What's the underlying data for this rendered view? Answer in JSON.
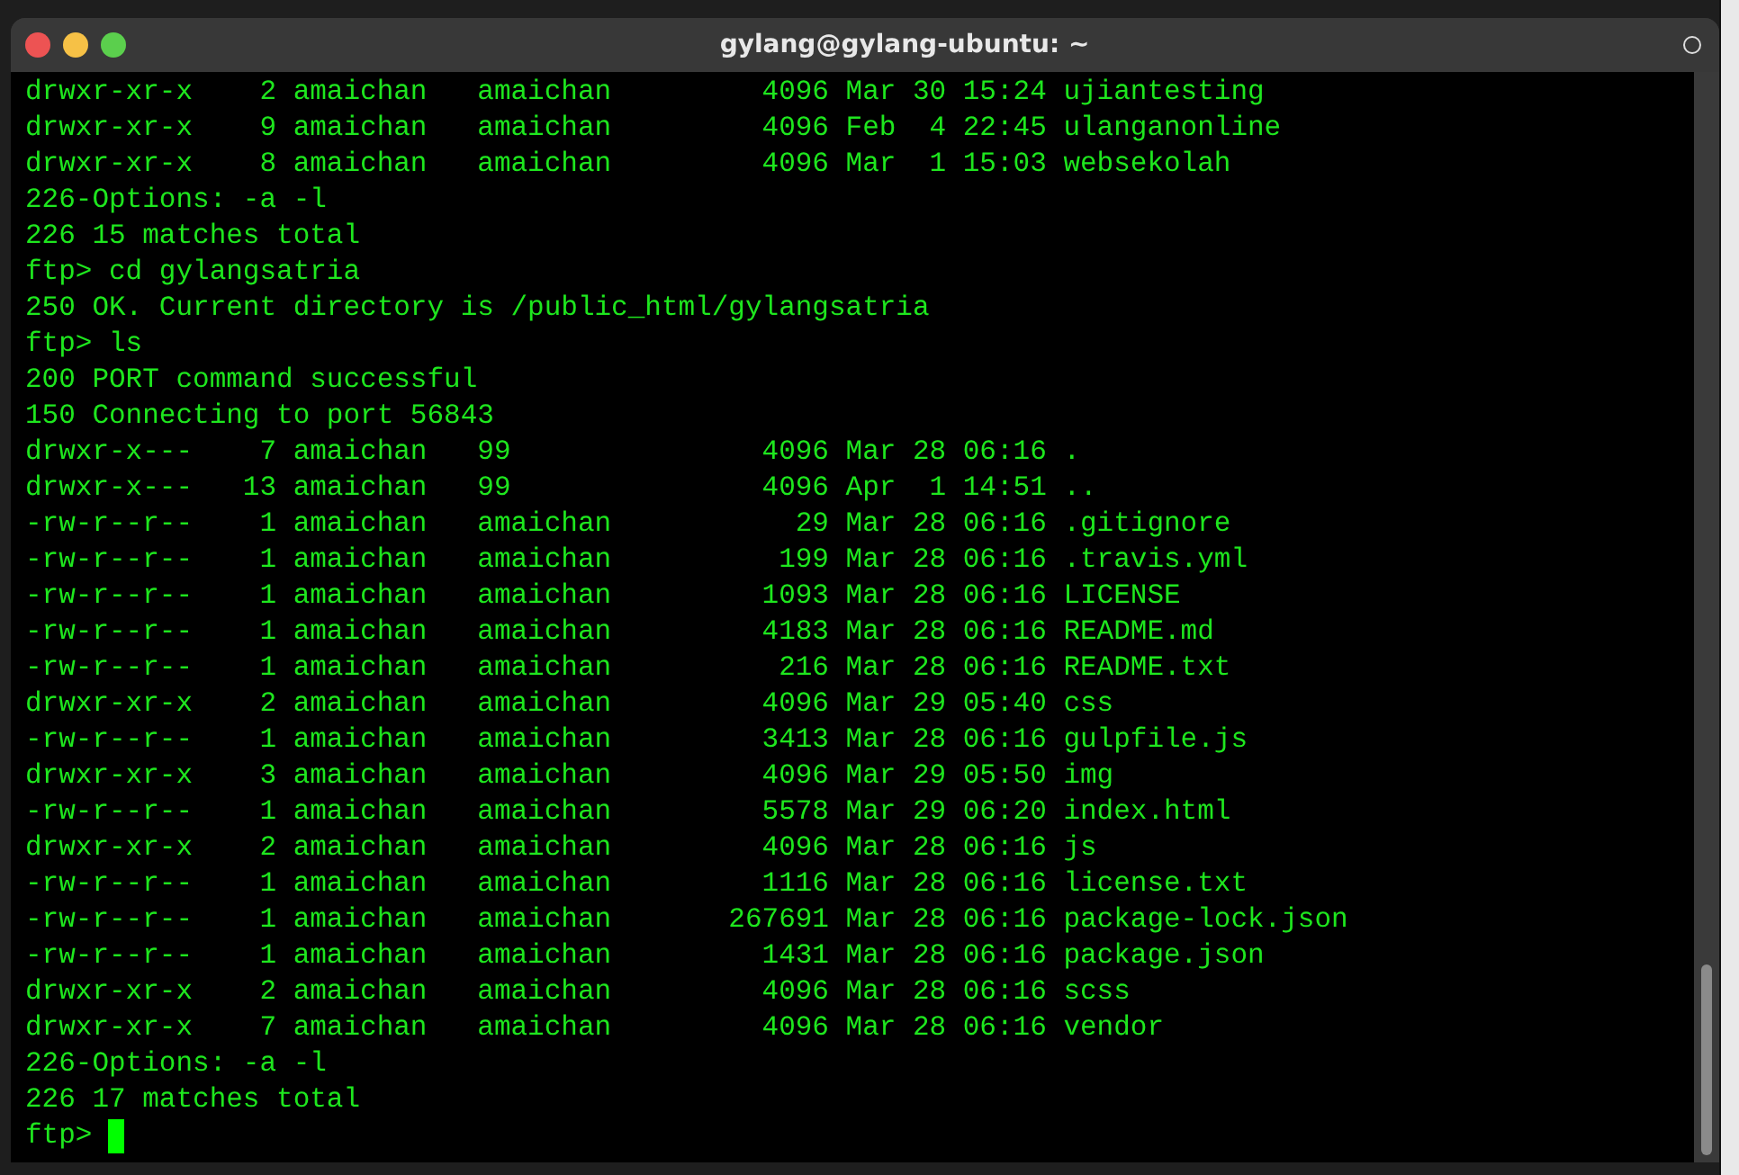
{
  "window": {
    "title": "gylang@gylang-ubuntu: ~"
  },
  "terminal": {
    "lines": [
      "drwxr-xr-x    2 amaichan   amaichan         4096 Mar 30 15:24 ujiantesting",
      "drwxr-xr-x    9 amaichan   amaichan         4096 Feb  4 22:45 ulanganonline",
      "drwxr-xr-x    8 amaichan   amaichan         4096 Mar  1 15:03 websekolah",
      "226-Options: -a -l",
      "226 15 matches total",
      "ftp> cd gylangsatria",
      "250 OK. Current directory is /public_html/gylangsatria",
      "ftp> ls",
      "200 PORT command successful",
      "150 Connecting to port 56843",
      "drwxr-x---    7 amaichan   99               4096 Mar 28 06:16 .",
      "drwxr-x---   13 amaichan   99               4096 Apr  1 14:51 ..",
      "-rw-r--r--    1 amaichan   amaichan           29 Mar 28 06:16 .gitignore",
      "-rw-r--r--    1 amaichan   amaichan          199 Mar 28 06:16 .travis.yml",
      "-rw-r--r--    1 amaichan   amaichan         1093 Mar 28 06:16 LICENSE",
      "-rw-r--r--    1 amaichan   amaichan         4183 Mar 28 06:16 README.md",
      "-rw-r--r--    1 amaichan   amaichan          216 Mar 28 06:16 README.txt",
      "drwxr-xr-x    2 amaichan   amaichan         4096 Mar 29 05:40 css",
      "-rw-r--r--    1 amaichan   amaichan         3413 Mar 28 06:16 gulpfile.js",
      "drwxr-xr-x    3 amaichan   amaichan         4096 Mar 29 05:50 img",
      "-rw-r--r--    1 amaichan   amaichan         5578 Mar 29 06:20 index.html",
      "drwxr-xr-x    2 amaichan   amaichan         4096 Mar 28 06:16 js",
      "-rw-r--r--    1 amaichan   amaichan         1116 Mar 28 06:16 license.txt",
      "-rw-r--r--    1 amaichan   amaichan       267691 Mar 28 06:16 package-lock.json",
      "-rw-r--r--    1 amaichan   amaichan         1431 Mar 28 06:16 package.json",
      "drwxr-xr-x    2 amaichan   amaichan         4096 Mar 28 06:16 scss",
      "drwxr-xr-x    7 amaichan   amaichan         4096 Mar 28 06:16 vendor",
      "226-Options: -a -l",
      "226 17 matches total"
    ],
    "prompt": "ftp>"
  }
}
